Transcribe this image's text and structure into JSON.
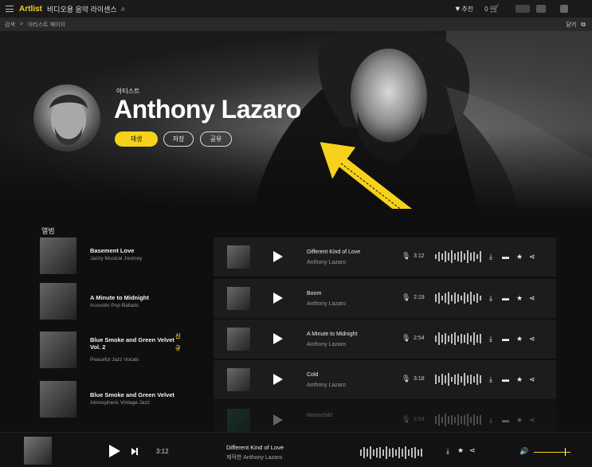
{
  "nav": {
    "logo": "Artlist",
    "title": "비디오용 음악 라이센스",
    "recommend": "추천",
    "cart_count": "0"
  },
  "breadcrumb": {
    "root": "검색",
    "sep": ">",
    "current": "아티스트 페이지",
    "close": "닫기"
  },
  "artist": {
    "label": "아티스트",
    "name": "Anthony Lazaro",
    "play": "재생",
    "save": "저장",
    "share": "공유"
  },
  "albums": {
    "title": "앨범",
    "items": [
      {
        "title": "Basement Love",
        "sub": "Jazzy Musical Journey",
        "is_new": false
      },
      {
        "title": "A Minute to Midnight",
        "sub": "Acoustic Pop Ballads",
        "is_new": false
      },
      {
        "title": "Blue Smoke and Green Velvet Vol. 2",
        "sub": "Peaceful Jazz Vocals",
        "is_new": true,
        "new1": "신",
        "new2": "규"
      },
      {
        "title": "Blue Smoke and Green Velvet",
        "sub": "Atmospheric Vintage Jazz",
        "is_new": false
      }
    ]
  },
  "tracks": [
    {
      "name": "Different Kind of Love",
      "artist": "Anthony Lazaro",
      "duration": "3:12"
    },
    {
      "name": "Boom",
      "artist": "Anthony Lazaro",
      "duration": "2:19"
    },
    {
      "name": "A Minute to Midnight",
      "artist": "Anthony Lazaro",
      "duration": "2:54"
    },
    {
      "name": "Cold",
      "artist": "Anthony Lazaro",
      "duration": "3:18"
    },
    {
      "name": "Moonchild",
      "artist": "",
      "duration": "3:54"
    }
  ],
  "player": {
    "time": "3:12",
    "track": "Different Kind of Love",
    "by": "제작한 Anthony Lazaro"
  },
  "colors": {
    "accent": "#f6d21b"
  }
}
